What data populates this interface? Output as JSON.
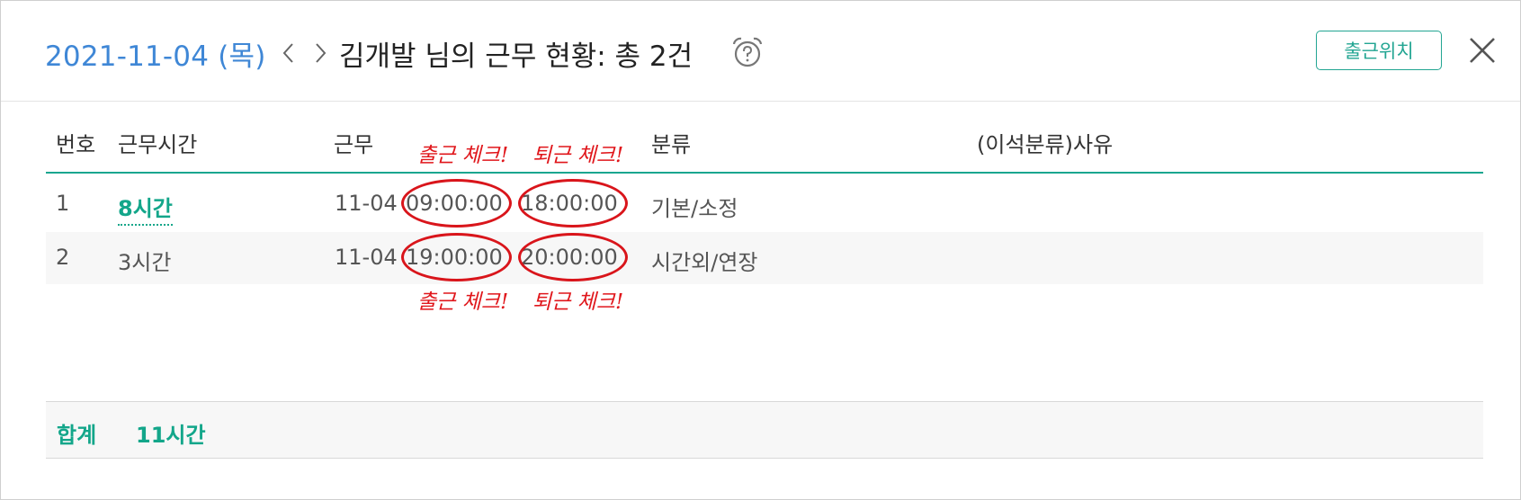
{
  "header": {
    "date": "2021-11-04 (목)",
    "title": "김개발 님의 근무 현황: 총 2건",
    "location_button": "출근위치"
  },
  "table": {
    "columns": [
      "번호",
      "근무시간",
      "근무",
      "분류",
      "(이석분류)사유"
    ],
    "rows": [
      {
        "no": "1",
        "hours": "8시간",
        "date": "11-04",
        "start": "09:00:00",
        "end": "18:00:00",
        "category": "기본/소정",
        "reason": ""
      },
      {
        "no": "2",
        "hours": "3시간",
        "date": "11-04",
        "start": "19:00:00",
        "end": "20:00:00",
        "category": "시간외/연장",
        "reason": ""
      }
    ]
  },
  "summary": {
    "label": "합계",
    "value": "11시간"
  },
  "annotations": {
    "check_in": "출근 체크!",
    "check_out": "퇴근 체크!"
  },
  "colors": {
    "accent": "#13a68a",
    "date": "#3f87d6",
    "annotation": "#e0161b"
  },
  "icons": [
    "chevron-left-icon",
    "chevron-right-icon",
    "alarm-clock-icon",
    "close-icon"
  ]
}
